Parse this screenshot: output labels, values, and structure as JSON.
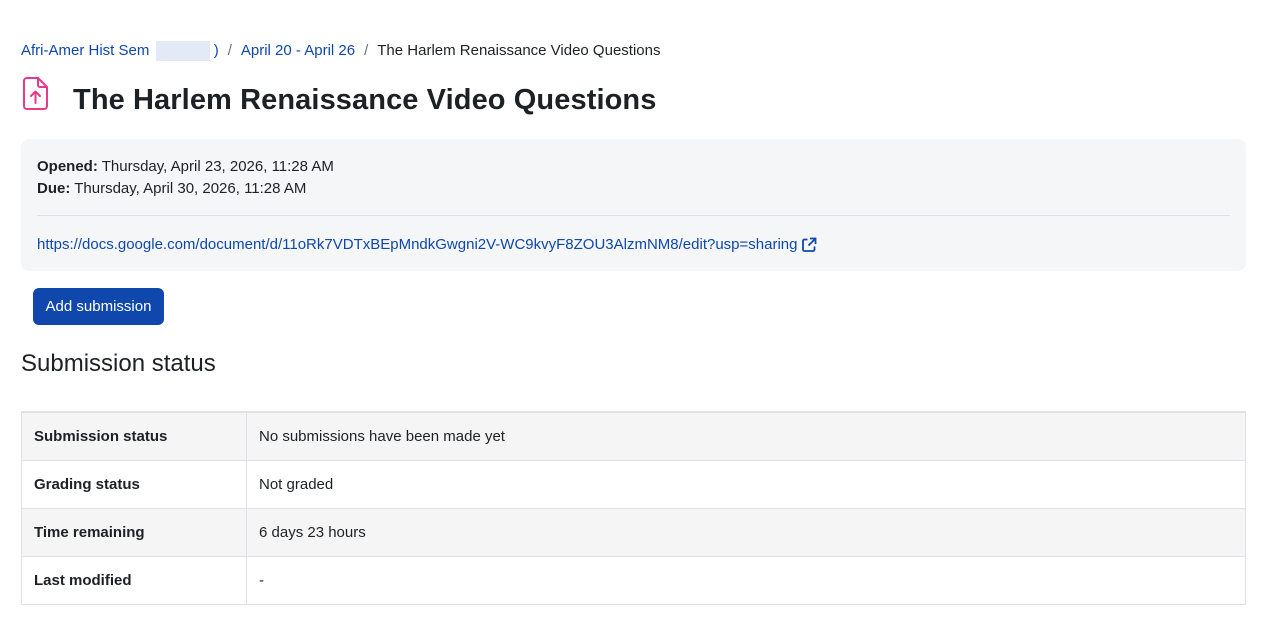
{
  "breadcrumb": {
    "course": "Afri-Amer Hist Sem",
    "course_suffix": ")",
    "separator": "/",
    "week": "April 20 - April 26",
    "current": "The Harlem Renaissance Video Questions"
  },
  "header": {
    "icon": "assignment-upload-icon",
    "icon_color": "#e6398a",
    "title": "The Harlem Renaissance Video Questions"
  },
  "dates": {
    "opened_label": "Opened:",
    "opened_value": "Thursday, April 23, 2026, 11:28 AM",
    "due_label": "Due:",
    "due_value": "Thursday, April 30, 2026, 11:28 AM"
  },
  "link": {
    "url": "https://docs.google.com/document/d/11oRk7VDTxBEpMndkGwgni2V-WC9kvyF8ZOU3AlzmNM8/edit?usp=sharing",
    "icon": "external-link-icon"
  },
  "actions": {
    "add_submission": "Add submission"
  },
  "submission": {
    "heading": "Submission status",
    "rows": [
      {
        "label": "Submission status",
        "value": "No submissions have been made yet"
      },
      {
        "label": "Grading status",
        "value": "Not graded"
      },
      {
        "label": "Time remaining",
        "value": "6 days 23 hours"
      },
      {
        "label": "Last modified",
        "value": "-"
      }
    ]
  },
  "colors": {
    "link": "#0f47ad",
    "primary_button": "#0f47ad",
    "info_background": "#f5f6f8"
  }
}
